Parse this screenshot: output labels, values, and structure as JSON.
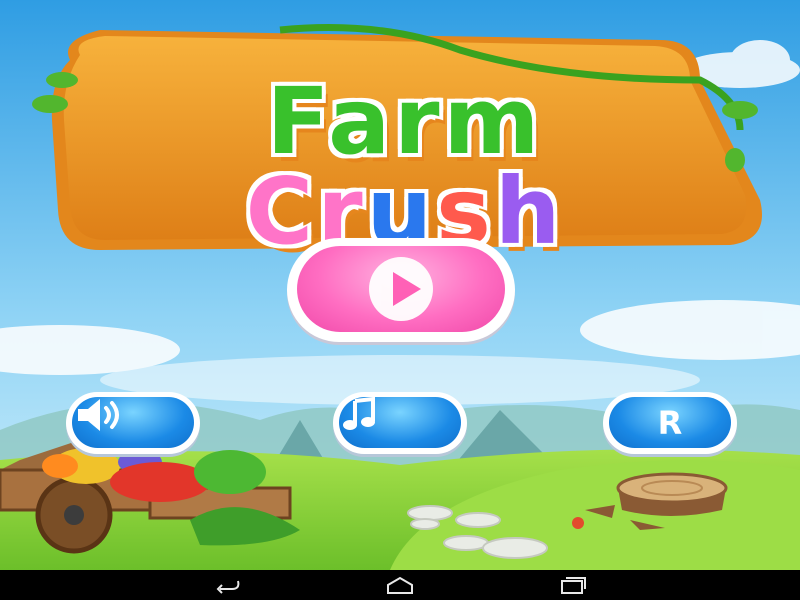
{
  "app": {
    "title_line1": "Farm",
    "title_line2_letters": [
      "C",
      "r",
      "u",
      "s",
      "h"
    ],
    "title_line2_colors": [
      "#ff74c8",
      "#ff74c8",
      "#2a78ee",
      "#ff5a4d",
      "#9a5cf0"
    ]
  },
  "menu": {
    "play_icon": "play-icon",
    "sound_icon": "speaker-icon",
    "music_icon": "music-note-icon",
    "reset_label": "R"
  },
  "navbar": {
    "back_icon": "back-arrow-icon",
    "home_icon": "home-icon",
    "recent_icon": "recent-apps-icon"
  },
  "colors": {
    "sky_top": "#3ba6e6",
    "sky_bottom": "#bfe9fb",
    "grass": "#8fd43c",
    "logo_frame": "#f1a029",
    "play_button": "#ff6ec2",
    "round_button": "#1b8ae6"
  }
}
